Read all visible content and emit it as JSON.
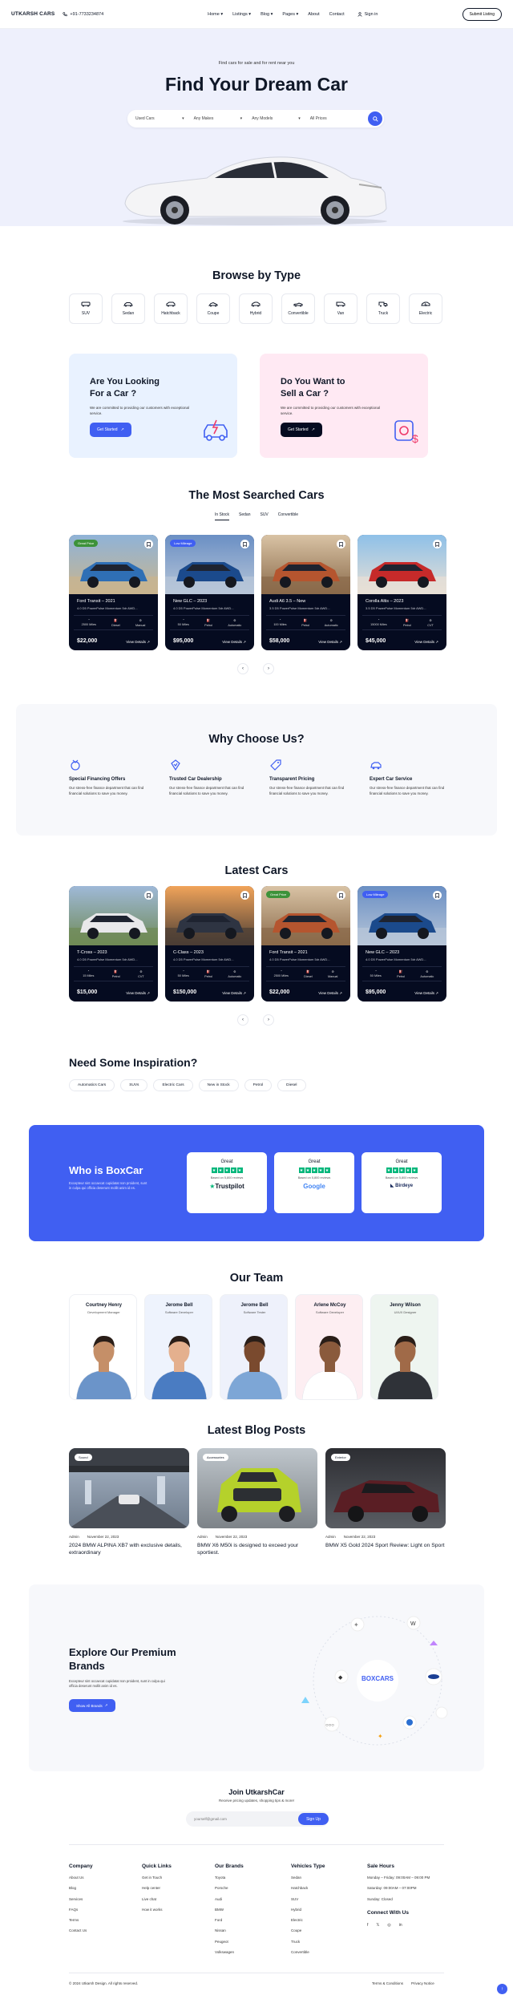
{
  "header": {
    "logo": "UTKARSH CARS",
    "phone": "+91-7733234874",
    "nav": [
      "Home",
      "Listings",
      "Blog",
      "Pages",
      "About",
      "Contact"
    ],
    "signin": "Sign in",
    "submit": "Submit Listing"
  },
  "hero": {
    "subtitle": "Find cars for sale and for rent near you",
    "title": "Find Your Dream Car",
    "search": [
      "Used Cars",
      "Any Makes",
      "Any Models",
      "All Prices"
    ]
  },
  "types": {
    "title": "Browse by Type",
    "items": [
      "SUV",
      "Sedan",
      "Hatchback",
      "Coupe",
      "Hybrid",
      "Convertible",
      "Van",
      "Truck",
      "Electric"
    ]
  },
  "promo": [
    {
      "title1": "Are You Looking",
      "title2": "For a Car ?",
      "text": "We are committed to providing our customers with exceptional service.",
      "button": "Get Started"
    },
    {
      "title1": "Do You Want to",
      "title2": "Sell a Car ?",
      "text": "We are committed to providing our customers with exceptional service.",
      "button": "Get Started"
    }
  ],
  "searched": {
    "title": "The Most Searched Cars",
    "tabs": [
      "In Stock",
      "Sedan",
      "SUV",
      "Convertible"
    ],
    "cars": [
      {
        "badge": "Great Price",
        "title": "Ford Transit – 2021",
        "desc": "4.0 D5 PowerPulse Momentum 5dr AWD...",
        "miles": "2500 Miles",
        "fuel": "Diesel",
        "trans": "Manual",
        "price": "$22,000"
      },
      {
        "badge": "Low Mileage",
        "title": "New GLC – 2023",
        "desc": "4.0 D5 PowerPulse Momentum 5dr AWD...",
        "miles": "50 Miles",
        "fuel": "Petrol",
        "trans": "Automatic",
        "price": "$95,000"
      },
      {
        "badge": "",
        "title": "Audi A6 3.5 – New",
        "desc": "3.5 D5 PowerPulse Momentum 5dr AWD...",
        "miles": "100 Miles",
        "fuel": "Petrol",
        "trans": "Automatic",
        "price": "$58,000"
      },
      {
        "badge": "",
        "title": "Corolla Altis – 2023",
        "desc": "3.5 D5 PowerPulse Momentum 5dr AWD...",
        "miles": "15000 Miles",
        "fuel": "Petrol",
        "trans": "CVT",
        "price": "$45,000"
      }
    ],
    "view": "View Details"
  },
  "why": {
    "title": "Why Choose Us?",
    "items": [
      {
        "title": "Special Financing Offers",
        "text": "Our stress-free finance department that can find financial solutions to save you money."
      },
      {
        "title": "Trusted Car Dealership",
        "text": "Our stress-free finance department that can find financial solutions to save you money."
      },
      {
        "title": "Transparent Pricing",
        "text": "Our stress-free finance department that can find financial solutions to save you money."
      },
      {
        "title": "Expert Car Service",
        "text": "Our stress-free finance department that can find financial solutions to save you money."
      }
    ]
  },
  "latest": {
    "title": "Latest Cars",
    "cars": [
      {
        "badge": "",
        "title": "T-Cross – 2023",
        "desc": "4.0 D5 PowerPulse Momentum 5dr AWD...",
        "miles": "15 Miles",
        "fuel": "Petrol",
        "trans": "CVT",
        "price": "$15,000"
      },
      {
        "badge": "",
        "title": "C-Class – 2023",
        "desc": "4.0 D5 PowerPulse Momentum 5dr AWD...",
        "miles": "50 Miles",
        "fuel": "Petrol",
        "trans": "Automatic",
        "price": "$150,000"
      },
      {
        "badge": "Great Price",
        "title": "Ford Transit – 2021",
        "desc": "4.0 D5 PowerPulse Momentum 5dr AWD...",
        "miles": "2500 Miles",
        "fuel": "Diesel",
        "trans": "Manual",
        "price": "$22,000"
      },
      {
        "badge": "Low Mileage",
        "title": "New GLC – 2023",
        "desc": "4.0 D5 PowerPulse Momentum 5dr AWD...",
        "miles": "50 Miles",
        "fuel": "Petrol",
        "trans": "Automatic",
        "price": "$95,000"
      }
    ]
  },
  "inspiration": {
    "title": "Need Some Inspiration?",
    "chips": [
      "Automatics Cars",
      "SUVs",
      "Electric Cars",
      "New in Stock",
      "Petrol",
      "Diesel"
    ]
  },
  "who": {
    "title": "Who is BoxCar",
    "text": "Excepteur sint occaecat cupidatat non proident, sunt in culpa qui officia deserunt mollit anim id es.",
    "reviews": [
      {
        "grade": "Great",
        "based": "Based on 5,800 reviews",
        "brand": "Trustpilot"
      },
      {
        "grade": "Great",
        "based": "Based on 5,800 reviews",
        "brand": "Google"
      },
      {
        "grade": "Great",
        "based": "Based on 5,800 reviews",
        "brand": "Birdeye"
      }
    ]
  },
  "team": {
    "title": "Our Team",
    "members": [
      {
        "name": "Courtney Henry",
        "role": "Development Manager"
      },
      {
        "name": "Jerome Bell",
        "role": "Software Developer"
      },
      {
        "name": "Jerome Bell",
        "role": "Software Tester"
      },
      {
        "name": "Arlene McCoy",
        "role": "Software Developer"
      },
      {
        "name": "Jenny Wilson",
        "role": "UI/UX Designer"
      }
    ]
  },
  "blog": {
    "title": "Latest Blog Posts",
    "posts": [
      {
        "tag": "Sound",
        "author": "Admin",
        "date": "November 22, 2023",
        "title": "2024 BMW ALPINA XB7 with exclusive details, extraordinary"
      },
      {
        "tag": "Accessories",
        "author": "Admin",
        "date": "November 22, 2023",
        "title": "BMW X6 M50i is designed to exceed your sportiest."
      },
      {
        "tag": "Exterior",
        "author": "Admin",
        "date": "November 22, 2023",
        "title": "BMW X5 Gold 2024 Sport Review: Light on Sport"
      }
    ]
  },
  "explore": {
    "title": "Explore Our Premium Brands",
    "text": "Excepteur sint occaecat cupidatat non proident, sunt in culpa qui officia deserunt mollit anim id es.",
    "button": "Show All Brands",
    "center": "BOXCARS"
  },
  "join": {
    "title": "Join UtkarshCar",
    "subtitle": "Receive pricing updates, shopping tips & more!",
    "placeholder": "yourself@gmail.com",
    "button": "Sign Up"
  },
  "footer": {
    "company": {
      "title": "Company",
      "items": [
        "About Us",
        "Blog",
        "Services",
        "FAQs",
        "Terms",
        "Contact Us"
      ]
    },
    "quick": {
      "title": "Quick Links",
      "items": [
        "Get in Touch",
        "Help center",
        "Live chat",
        "How it works"
      ]
    },
    "brands": {
      "title": "Our Brands",
      "items": [
        "Toyota",
        "Porsche",
        "Audi",
        "BMW",
        "Ford",
        "Nissan",
        "Peugeot",
        "Volkswagen"
      ]
    },
    "vehicles": {
      "title": "Vehicles Type",
      "items": [
        "Sedan",
        "Hatchback",
        "SUV",
        "Hybrid",
        "Electric",
        "Coupe",
        "Truck",
        "Convertible"
      ]
    },
    "hours": {
      "title": "Sale Hours",
      "items": [
        "Monday – Friday: 09:00AM – 09:00 PM",
        "Saturday: 09:00AM – 07:00PM",
        "Sunday: Closed"
      ]
    },
    "connect": "Connect With Us",
    "copyright": "© 2024 Utkarsh Design. All rights reserved.",
    "terms": "Terms & Conditions",
    "privacy": "Privacy Notice"
  }
}
